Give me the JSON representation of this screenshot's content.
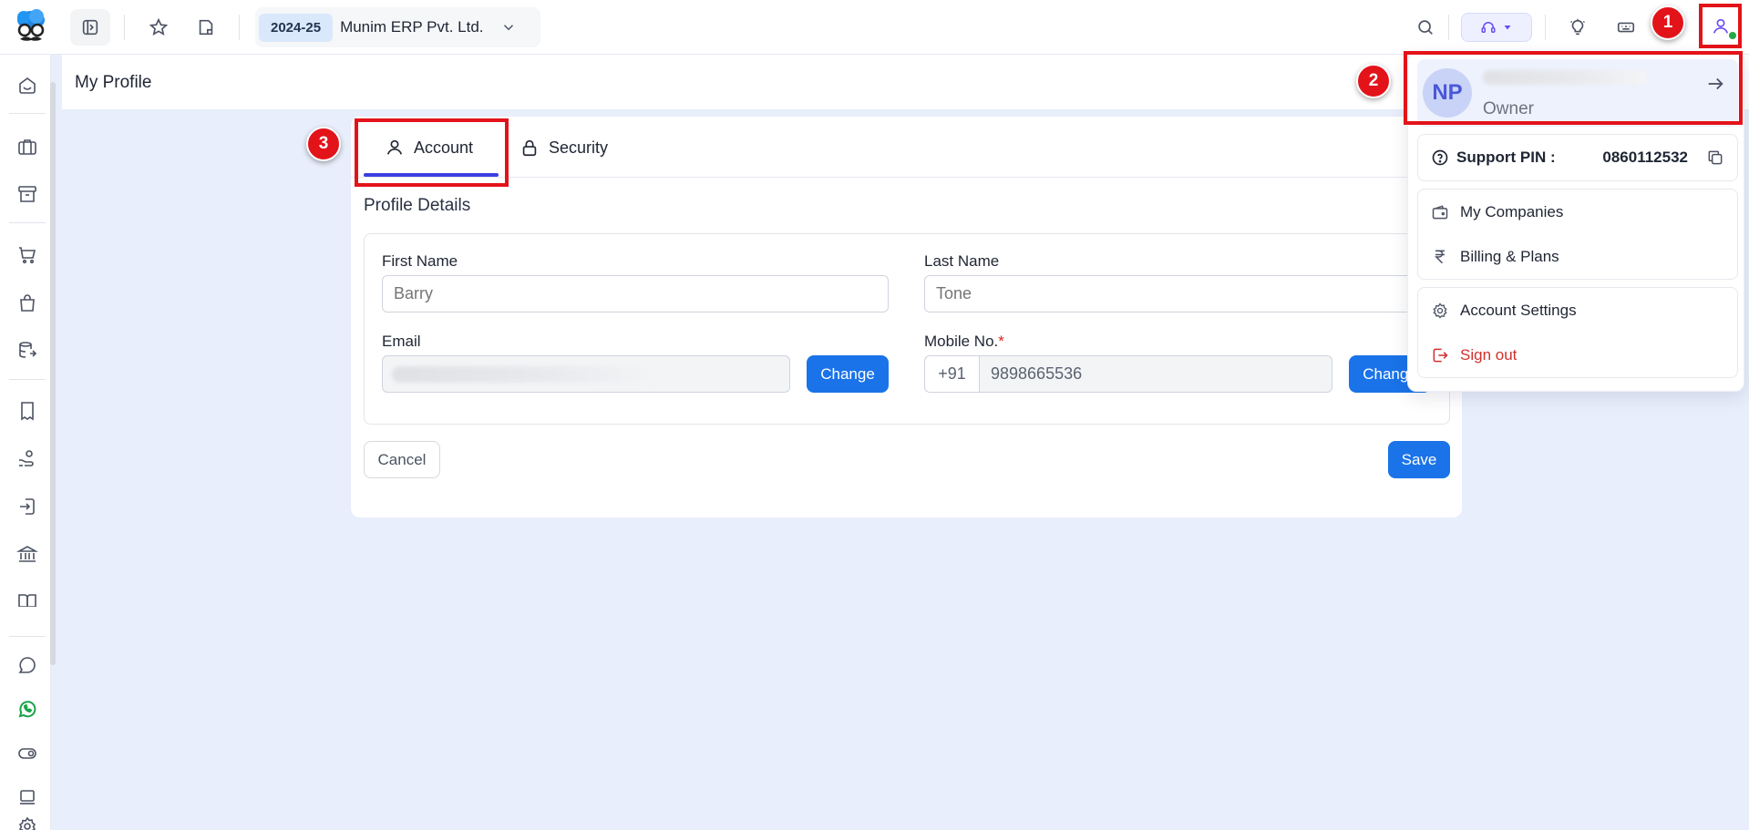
{
  "header": {
    "financial_year": "2024-25",
    "company_name": "Munim ERP Pvt. Ltd."
  },
  "page": {
    "title": "My Profile"
  },
  "tabs": [
    {
      "label": "Account",
      "icon": "user-icon",
      "active": true
    },
    {
      "label": "Security",
      "icon": "lock-icon",
      "active": false
    }
  ],
  "profile_details": {
    "section_title": "Profile Details",
    "first_name_label": "First Name",
    "first_name_value": "Barry",
    "last_name_label": "Last Name",
    "last_name_value": "Tone",
    "email_label": "Email",
    "email_change": "Change",
    "mobile_label": "Mobile No.",
    "mobile_required_mark": "*",
    "mobile_prefix": "+91",
    "mobile_value": "9898665536",
    "mobile_change": "Change"
  },
  "actions": {
    "cancel": "Cancel",
    "save": "Save"
  },
  "dropdown": {
    "avatar_initials": "NP",
    "role": "Owner",
    "support_pin_label": "Support PIN :",
    "support_pin_value": "0860112532",
    "my_companies": "My Companies",
    "billing_plans": "Billing & Plans",
    "account_settings": "Account Settings",
    "sign_out": "Sign out"
  },
  "annotations": [
    "1",
    "2",
    "3"
  ],
  "colors": {
    "accent": "#1a73e8",
    "tab_active": "#3b3fe0",
    "annotation_red": "#e3131a",
    "background": "#e8eefb"
  }
}
